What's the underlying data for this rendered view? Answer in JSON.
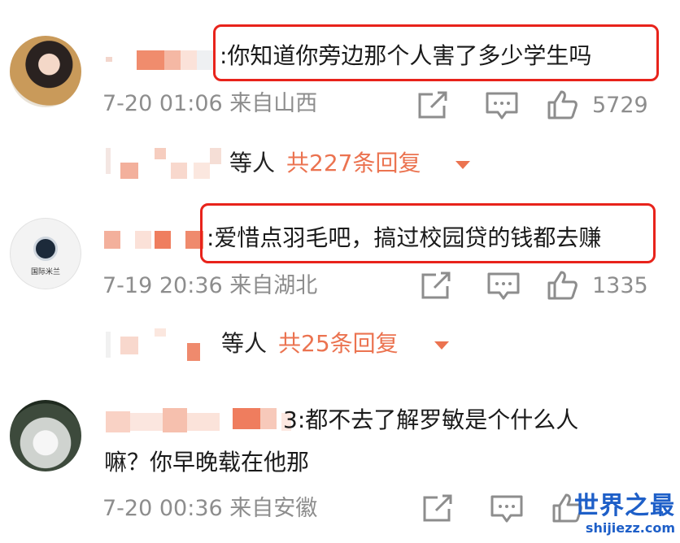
{
  "comments": [
    {
      "text": ":你知道你旁边那个人害了多少学生吗",
      "time": "7-20 01:06",
      "location": "来自山西",
      "likes": "5729",
      "replies_by": "等人",
      "replies_total": "共227条回复"
    },
    {
      "text": ":爱惜点羽毛吧，搞过校园贷的钱都去赚",
      "avatar_text": "国际米兰",
      "time": "7-19 20:36",
      "location": "来自湖北",
      "likes": "1335",
      "replies_by": "等人",
      "replies_total": "共25条回复"
    },
    {
      "text_line1": "3:都不去了解罗敏是个什么人",
      "text_line2": "嘛？你早晚载在他那",
      "time": "7-20 00:36",
      "location": "来自安徽"
    }
  ],
  "watermark": {
    "cn": "世界之最",
    "en": "shijiezz.com"
  },
  "icons": [
    "share-icon",
    "comment-icon",
    "like-icon",
    "chevron-down-icon"
  ],
  "colors": {
    "highlight": "#e8231b",
    "reply_accent": "#eb7350",
    "meta_gray": "#8d8d8d",
    "watermark": "#1e5fc8"
  }
}
